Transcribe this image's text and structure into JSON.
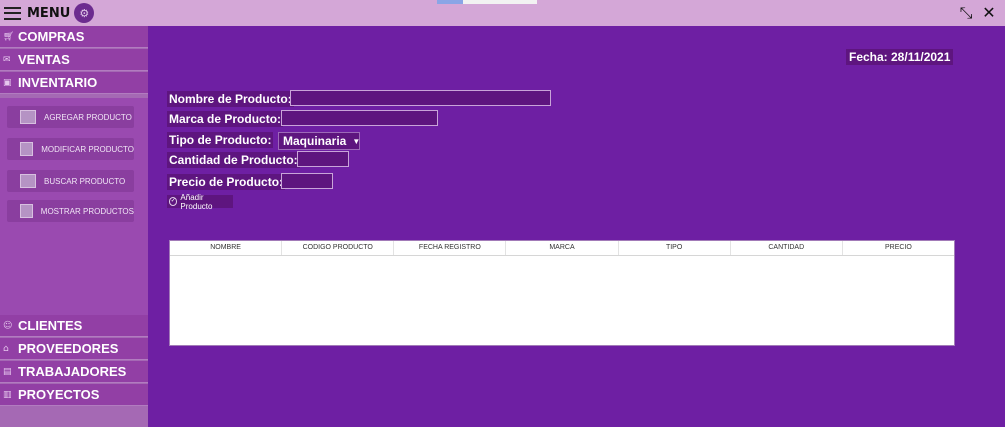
{
  "topbar": {
    "menu_label": "MENU"
  },
  "sidebar": {
    "nav_items": [
      {
        "label": "COMPRAS"
      },
      {
        "label": "VENTAS"
      },
      {
        "label": "INVENTARIO"
      }
    ],
    "sub_items": [
      {
        "label": "AGREGAR PRODUCTO"
      },
      {
        "label": "MODIFICAR PRODUCTO"
      },
      {
        "label": "BUSCAR PRODUCTO"
      },
      {
        "label": "MOSTRAR PRODUCTOS"
      }
    ],
    "bottom_items": [
      {
        "label": "CLIENTES"
      },
      {
        "label": "PROVEEDORES"
      },
      {
        "label": "TRABAJADORES"
      },
      {
        "label": "PROYECTOS"
      }
    ]
  },
  "main": {
    "date": "Fecha: 28/11/2021",
    "form": {
      "nombre_label": "Nombre de Producto:",
      "nombre_value": "",
      "marca_label": "Marca de Producto:",
      "marca_value": "",
      "tipo_label": "Tipo de Producto:",
      "tipo_selected": "Maquinaria",
      "cantidad_label": "Cantidad de Producto:",
      "cantidad_value": "",
      "precio_label": "Precio de Producto:",
      "precio_value": "",
      "add_button": "Añadir Producto"
    },
    "table": {
      "columns": [
        "NOMBRE",
        "CODIGO PRODUCTO",
        "FECHA REGISTRO",
        "MARCA",
        "TIPO",
        "CANTIDAD",
        "PRECIO"
      ],
      "rows": []
    }
  },
  "colors": {
    "main_bg": "#6e1fa3",
    "sidebar_bg": "#a569b4",
    "topbar_bg": "#d4a7d7",
    "field_bg": "#5e157f"
  }
}
